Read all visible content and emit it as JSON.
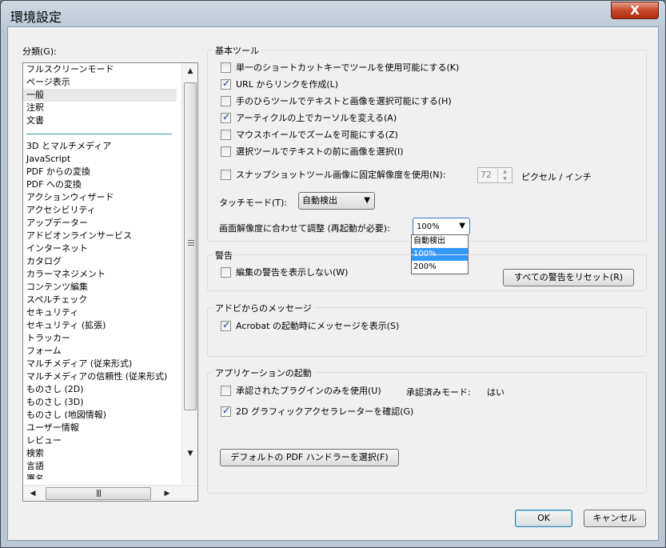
{
  "window": {
    "title": "環境設定",
    "close_label": "X"
  },
  "categories": {
    "label": "分類(G):",
    "items_top": [
      "フルスクリーンモード",
      "ページ表示",
      "一般",
      "注釈",
      "文書"
    ],
    "selected": "一般",
    "items_bottom": [
      "3D とマルチメディア",
      "JavaScript",
      "PDF からの変換",
      "PDF への変換",
      "アクションウィザード",
      "アクセシビリティ",
      "アップデーター",
      "アドビオンラインサービス",
      "インターネット",
      "カタログ",
      "カラーマネジメント",
      "コンテンツ編集",
      "スペルチェック",
      "セキュリティ",
      "セキュリティ (拡張)",
      "トラッカー",
      "フォーム",
      "マルチメディア (従来形式)",
      "マルチメディアの信頼性 (従来形式)",
      "ものさし (2D)",
      "ものさし (3D)",
      "ものさし (地図情報)",
      "ユーザー情報",
      "レビュー",
      "検索",
      "言語",
      "署名"
    ]
  },
  "basic_tools": {
    "title": "基本ツール",
    "opt1": "単一のショートカットキーでツールを使用可能にする(K)",
    "opt2": "URL からリンクを作成(L)",
    "opt3": "手のひらツールでテキストと画像を選択可能にする(H)",
    "opt4": "アーティクルの上でカーソルを変える(A)",
    "opt5": "マウスホイールでズームを可能にする(Z)",
    "opt6": "選択ツールでテキストの前に画像を選択(I)",
    "opt7": "スナップショットツール画像に固定解像度を使用(N):",
    "resolution_value": "72",
    "resolution_unit": "ピクセル / インチ",
    "touch_mode_label": "タッチモード(T):",
    "touch_mode_value": "自動検出",
    "scale_label": "画面解像度に合わせて調整 (再起動が必要):",
    "scale_value": "100%",
    "scale_options": [
      "自動検出",
      "100%",
      "200%"
    ]
  },
  "warnings": {
    "title": "警告",
    "opt1": "編集の警告を表示しない(W)",
    "reset_button": "すべての警告をリセット(R)"
  },
  "messages": {
    "title": "アドビからのメッセージ",
    "opt1": "Acrobat の起動時にメッセージを表示(S)"
  },
  "startup": {
    "title": "アプリケーションの起動",
    "opt1": "承認されたプラグインのみを使用(U)",
    "certified_mode_label": "承認済みモード:",
    "certified_mode_value": "はい",
    "opt2": "2D グラフィックアクセラレーターを確認(G)",
    "pdf_handler_button": "デフォルトの PDF ハンドラーを選択(F)"
  },
  "footer": {
    "ok": "OK",
    "cancel": "キャンセル"
  }
}
